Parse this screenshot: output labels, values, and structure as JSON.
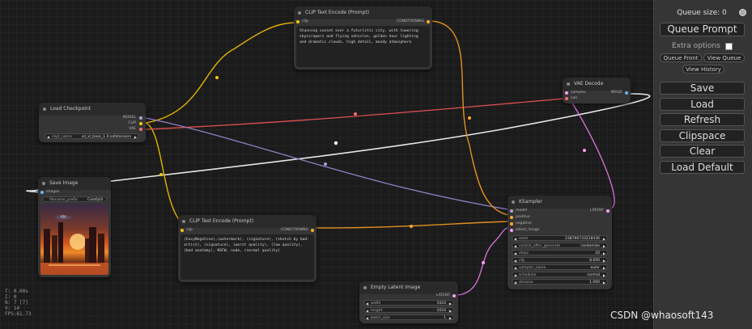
{
  "panel": {
    "queue_size": "Queue size: 0",
    "queue_prompt": "Queue Prompt",
    "extra_options": "Extra options",
    "queue_front": "Queue Front",
    "view_queue": "View Queue",
    "view_history": "View History",
    "save": "Save",
    "load": "Load",
    "refresh": "Refresh",
    "clipspace": "Clipspace",
    "clear": "Clear",
    "load_default": "Load Default"
  },
  "nodes": {
    "load_checkpoint": {
      "title": "Load Checkpoint",
      "outputs": [
        "MODEL",
        "CLIP",
        "VAE"
      ],
      "ckpt_label": "ckpt_name",
      "ckpt_value": "sd_xl_base_1.0.safetensors"
    },
    "clip_pos": {
      "title": "CLIP Text Encode (Prompt)",
      "input": "clip",
      "output": "CONDITIONING",
      "text": "Stunning sunset over a futuristic city, with towering skyscrapers and flying vehicles, golden hour lighting and dramatic clouds, high detail, moody atmosphere"
    },
    "clip_neg": {
      "title": "CLIP Text Encode (Prompt)",
      "input": "clip",
      "output": "CONDITIONING",
      "text": "(EasyNegative),(watermark), (signature), (sketch by bad-artist), (signature), (worst quality), (low quality), (bad anatomy), NSFW, nude, (normal quality)"
    },
    "vae_decode": {
      "title": "VAE Decode",
      "inputs": [
        "samples",
        "vae"
      ],
      "output": "IMAGE"
    },
    "save_image": {
      "title": "Save Image",
      "input": "images",
      "prefix_label": "filename_prefix",
      "prefix_value": "ComfyUI"
    },
    "ksampler": {
      "title": "KSampler",
      "inputs": [
        "model",
        "positive",
        "negative",
        "latent_image"
      ],
      "output": "LATENT",
      "widgets": [
        {
          "label": "seed",
          "value": "238766733218436"
        },
        {
          "label": "control_after_generate",
          "value": "randomize"
        },
        {
          "label": "steps",
          "value": "20"
        },
        {
          "label": "cfg",
          "value": "8.000"
        },
        {
          "label": "sampler_name",
          "value": "euler"
        },
        {
          "label": "scheduler",
          "value": "normal"
        },
        {
          "label": "denoise",
          "value": "1.000"
        }
      ]
    },
    "empty_latent": {
      "title": "Empty Latent Image",
      "output": "LATENT",
      "widgets": [
        {
          "label": "width",
          "value": "1024"
        },
        {
          "label": "height",
          "value": "1024"
        },
        {
          "label": "batch_size",
          "value": "1"
        }
      ]
    }
  },
  "stats": [
    "T: 0.00s",
    "I: 0",
    "N: 7 [7]",
    "V: 14",
    "FPS:61.73"
  ],
  "watermark": "CSDN @whaosoft143",
  "colors": {
    "model": "#b39ddb",
    "clip": "#f2c713",
    "vae": "#ff6e6e",
    "conditioning": "#ffa931",
    "latent": "#ff9cf9",
    "image": "#64b5f6",
    "white_wire": "#e8e8e8"
  }
}
